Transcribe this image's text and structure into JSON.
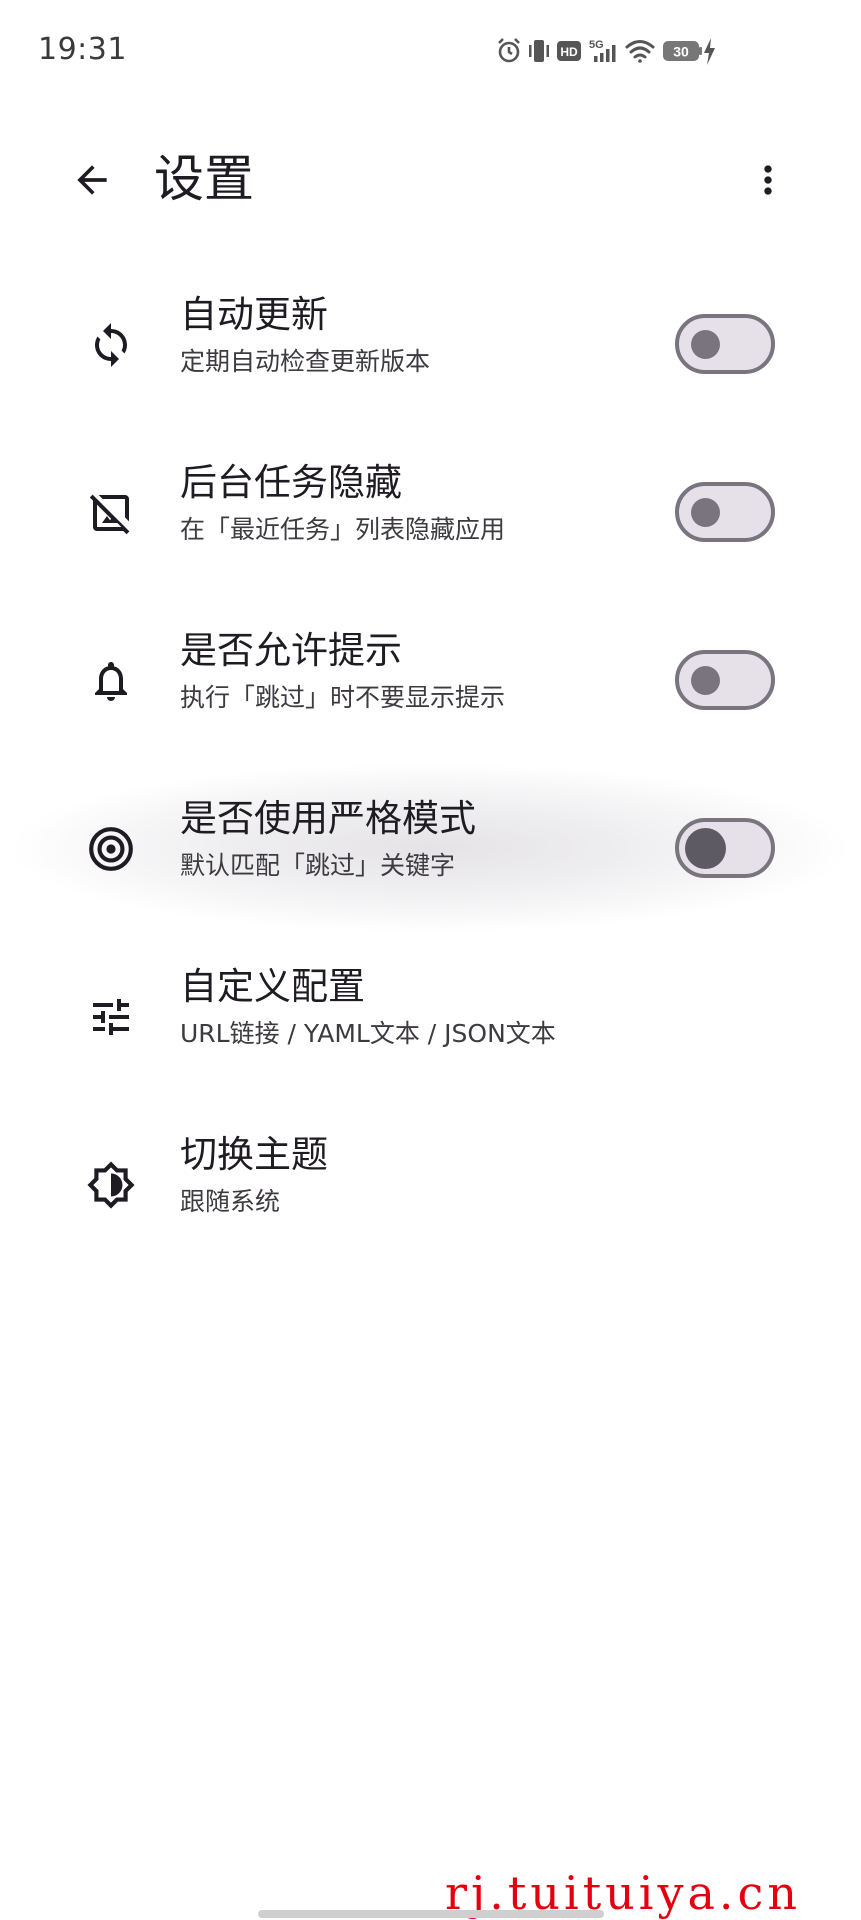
{
  "status_bar": {
    "time": "19:31",
    "battery": "30",
    "network": "5G"
  },
  "app_bar": {
    "title": "设置",
    "back_icon": "arrow-back-icon",
    "menu_icon": "more-vert-icon"
  },
  "settings": [
    {
      "icon": "sync-icon",
      "title": "自动更新",
      "subtitle": "定期自动检查更新版本",
      "has_switch": true,
      "checked": false
    },
    {
      "icon": "hide-image-icon",
      "title": "后台任务隐藏",
      "subtitle": "在「最近任务」列表隐藏应用",
      "has_switch": true,
      "checked": false
    },
    {
      "icon": "bell-icon",
      "title": "是否允许提示",
      "subtitle": "执行「跳过」时不要显示提示",
      "has_switch": true,
      "checked": false
    },
    {
      "icon": "target-icon",
      "title": "是否使用严格模式",
      "subtitle": "默认匹配「跳过」关键字",
      "has_switch": true,
      "checked": false,
      "pressed": true
    },
    {
      "icon": "tune-icon",
      "title": "自定义配置",
      "subtitle": "URL链接 / YAML文本 / JSON文本",
      "has_switch": false
    },
    {
      "icon": "brightness-auto-icon",
      "title": "切换主题",
      "subtitle": "跟随系统",
      "has_switch": false
    }
  ],
  "watermark": "rj.tuituiya.cn",
  "colors": {
    "switch_track": "#e6e0e9",
    "switch_outline": "#79747e",
    "watermark": "#e3000f",
    "text_primary": "#1f1b22"
  }
}
